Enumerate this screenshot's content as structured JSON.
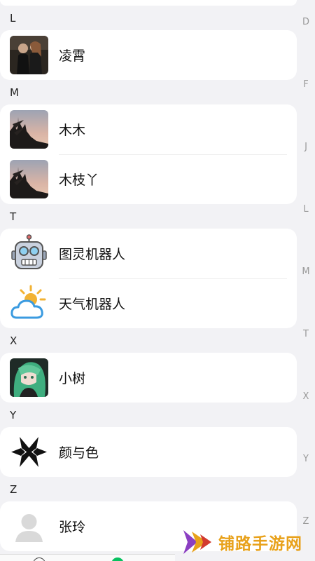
{
  "sections": [
    {
      "letter": "L",
      "contacts": [
        {
          "name": "凌霄",
          "avatar": "photo-avatar-couple"
        }
      ]
    },
    {
      "letter": "M",
      "contacts": [
        {
          "name": "木木",
          "avatar": "photo-avatar-sunset-tree"
        },
        {
          "name": "木枝丫",
          "avatar": "photo-avatar-sunset-tree"
        }
      ]
    },
    {
      "letter": "T",
      "contacts": [
        {
          "name": "图灵机器人",
          "avatar": "robot-icon"
        },
        {
          "name": "天气机器人",
          "avatar": "weather-cloud-sun-icon"
        }
      ]
    },
    {
      "letter": "X",
      "contacts": [
        {
          "name": "小树",
          "avatar": "anime-girl-avatar"
        }
      ]
    },
    {
      "letter": "Y",
      "contacts": [
        {
          "name": "颜与色",
          "avatar": "black-geometric-logo"
        }
      ]
    },
    {
      "letter": "Z",
      "contacts": [
        {
          "name": "张玲",
          "avatar": "default-user-icon"
        }
      ]
    }
  ],
  "index_letters": [
    "D",
    "F",
    "J",
    "L",
    "M",
    "T",
    "X",
    "Y",
    "Z"
  ],
  "watermark": {
    "text": "铺路手游网",
    "color": "#e8a11a"
  },
  "colors": {
    "background": "#f2f2f5",
    "card": "#ffffff",
    "index_text": "#999999",
    "tab_active": "#07c160"
  }
}
